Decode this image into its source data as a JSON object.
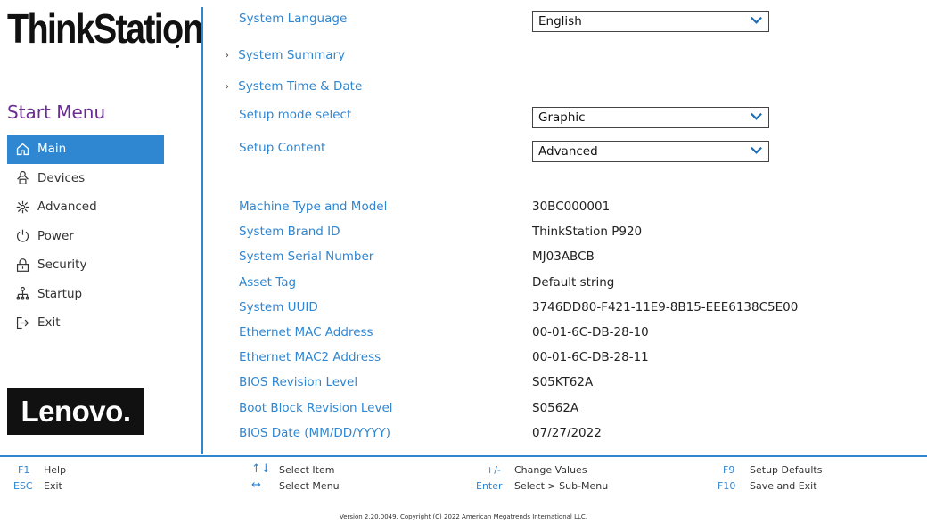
{
  "brand": {
    "title": "ThinkStation",
    "footer_logo": "Lenovo."
  },
  "sidebar": {
    "heading": "Start Menu",
    "items": [
      {
        "label": "Main",
        "icon": "home-icon",
        "active": true
      },
      {
        "label": "Devices",
        "icon": "devices-icon"
      },
      {
        "label": "Advanced",
        "icon": "advanced-icon"
      },
      {
        "label": "Power",
        "icon": "power-icon"
      },
      {
        "label": "Security",
        "icon": "lock-icon"
      },
      {
        "label": "Startup",
        "icon": "startup-icon"
      },
      {
        "label": "Exit",
        "icon": "exit-icon"
      }
    ]
  },
  "main": {
    "language": {
      "label": "System Language",
      "value": "English"
    },
    "summary_label": "System Summary",
    "time_label": "System Time & Date",
    "setup_mode": {
      "label": "Setup mode select",
      "value": "Graphic"
    },
    "setup_content": {
      "label": "Setup Content",
      "value": "Advanced"
    },
    "info": [
      {
        "label": "Machine Type and Model",
        "value": "30BC000001"
      },
      {
        "label": "System Brand ID",
        "value": "ThinkStation P920"
      },
      {
        "label": "System Serial Number",
        "value": "MJ03ABCB"
      },
      {
        "label": "Asset Tag",
        "value": "Default string"
      },
      {
        "label": "System UUID",
        "value": "3746DD80-F421-11E9-8B15-EEE6138C5E00"
      },
      {
        "label": "Ethernet MAC Address",
        "value": "00-01-6C-DB-28-10"
      },
      {
        "label": "Ethernet MAC2 Address",
        "value": "00-01-6C-DB-28-11"
      },
      {
        "label": "BIOS Revision Level",
        "value": "S05KT62A"
      },
      {
        "label": "Boot Block Revision Level",
        "value": "S0562A"
      },
      {
        "label": "BIOS Date (MM/DD/YYYY)",
        "value": "07/27/2022"
      }
    ]
  },
  "footer": {
    "help": {
      "key": "F1",
      "desc": "Help"
    },
    "exit": {
      "key": "ESC",
      "desc": "Exit"
    },
    "select_item": {
      "key": "↑↓",
      "desc": "Select Item"
    },
    "select_menu": {
      "key": "↔",
      "desc": "Select Menu"
    },
    "change_values": {
      "key": "+/-",
      "desc": "Change Values"
    },
    "sub_menu": {
      "key": "Enter",
      "desc": "Select > Sub-Menu"
    },
    "defaults": {
      "key": "F9",
      "desc": "Setup Defaults"
    },
    "save_exit": {
      "key": "F10",
      "desc": "Save and Exit"
    },
    "version": "Version 2.20.0049. Copyright (C) 2022 American Megatrends International LLC."
  },
  "colors": {
    "accent": "#2f86d1",
    "heading": "#6a2c91"
  }
}
